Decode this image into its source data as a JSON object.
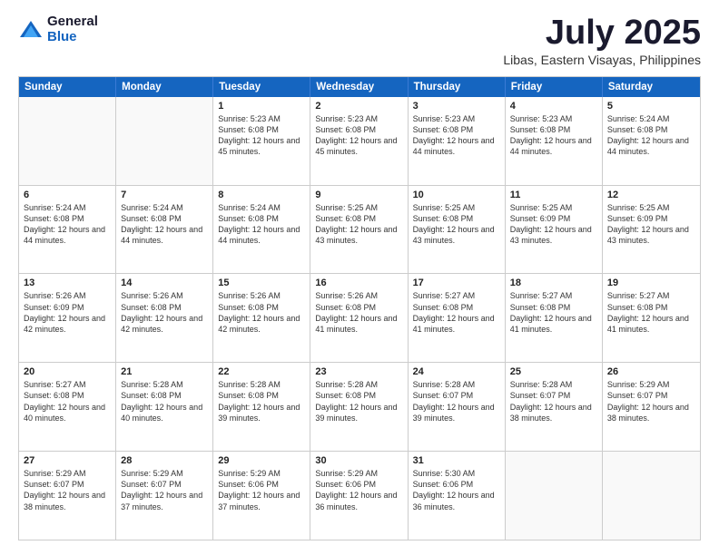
{
  "logo": {
    "general": "General",
    "blue": "Blue"
  },
  "title": "July 2025",
  "location": "Libas, Eastern Visayas, Philippines",
  "header_days": [
    "Sunday",
    "Monday",
    "Tuesday",
    "Wednesday",
    "Thursday",
    "Friday",
    "Saturday"
  ],
  "weeks": [
    [
      {
        "day": "",
        "info": ""
      },
      {
        "day": "",
        "info": ""
      },
      {
        "day": "1",
        "info": "Sunrise: 5:23 AM\nSunset: 6:08 PM\nDaylight: 12 hours and 45 minutes."
      },
      {
        "day": "2",
        "info": "Sunrise: 5:23 AM\nSunset: 6:08 PM\nDaylight: 12 hours and 45 minutes."
      },
      {
        "day": "3",
        "info": "Sunrise: 5:23 AM\nSunset: 6:08 PM\nDaylight: 12 hours and 44 minutes."
      },
      {
        "day": "4",
        "info": "Sunrise: 5:23 AM\nSunset: 6:08 PM\nDaylight: 12 hours and 44 minutes."
      },
      {
        "day": "5",
        "info": "Sunrise: 5:24 AM\nSunset: 6:08 PM\nDaylight: 12 hours and 44 minutes."
      }
    ],
    [
      {
        "day": "6",
        "info": "Sunrise: 5:24 AM\nSunset: 6:08 PM\nDaylight: 12 hours and 44 minutes."
      },
      {
        "day": "7",
        "info": "Sunrise: 5:24 AM\nSunset: 6:08 PM\nDaylight: 12 hours and 44 minutes."
      },
      {
        "day": "8",
        "info": "Sunrise: 5:24 AM\nSunset: 6:08 PM\nDaylight: 12 hours and 44 minutes."
      },
      {
        "day": "9",
        "info": "Sunrise: 5:25 AM\nSunset: 6:08 PM\nDaylight: 12 hours and 43 minutes."
      },
      {
        "day": "10",
        "info": "Sunrise: 5:25 AM\nSunset: 6:08 PM\nDaylight: 12 hours and 43 minutes."
      },
      {
        "day": "11",
        "info": "Sunrise: 5:25 AM\nSunset: 6:09 PM\nDaylight: 12 hours and 43 minutes."
      },
      {
        "day": "12",
        "info": "Sunrise: 5:25 AM\nSunset: 6:09 PM\nDaylight: 12 hours and 43 minutes."
      }
    ],
    [
      {
        "day": "13",
        "info": "Sunrise: 5:26 AM\nSunset: 6:09 PM\nDaylight: 12 hours and 42 minutes."
      },
      {
        "day": "14",
        "info": "Sunrise: 5:26 AM\nSunset: 6:08 PM\nDaylight: 12 hours and 42 minutes."
      },
      {
        "day": "15",
        "info": "Sunrise: 5:26 AM\nSunset: 6:08 PM\nDaylight: 12 hours and 42 minutes."
      },
      {
        "day": "16",
        "info": "Sunrise: 5:26 AM\nSunset: 6:08 PM\nDaylight: 12 hours and 41 minutes."
      },
      {
        "day": "17",
        "info": "Sunrise: 5:27 AM\nSunset: 6:08 PM\nDaylight: 12 hours and 41 minutes."
      },
      {
        "day": "18",
        "info": "Sunrise: 5:27 AM\nSunset: 6:08 PM\nDaylight: 12 hours and 41 minutes."
      },
      {
        "day": "19",
        "info": "Sunrise: 5:27 AM\nSunset: 6:08 PM\nDaylight: 12 hours and 41 minutes."
      }
    ],
    [
      {
        "day": "20",
        "info": "Sunrise: 5:27 AM\nSunset: 6:08 PM\nDaylight: 12 hours and 40 minutes."
      },
      {
        "day": "21",
        "info": "Sunrise: 5:28 AM\nSunset: 6:08 PM\nDaylight: 12 hours and 40 minutes."
      },
      {
        "day": "22",
        "info": "Sunrise: 5:28 AM\nSunset: 6:08 PM\nDaylight: 12 hours and 39 minutes."
      },
      {
        "day": "23",
        "info": "Sunrise: 5:28 AM\nSunset: 6:08 PM\nDaylight: 12 hours and 39 minutes."
      },
      {
        "day": "24",
        "info": "Sunrise: 5:28 AM\nSunset: 6:07 PM\nDaylight: 12 hours and 39 minutes."
      },
      {
        "day": "25",
        "info": "Sunrise: 5:28 AM\nSunset: 6:07 PM\nDaylight: 12 hours and 38 minutes."
      },
      {
        "day": "26",
        "info": "Sunrise: 5:29 AM\nSunset: 6:07 PM\nDaylight: 12 hours and 38 minutes."
      }
    ],
    [
      {
        "day": "27",
        "info": "Sunrise: 5:29 AM\nSunset: 6:07 PM\nDaylight: 12 hours and 38 minutes."
      },
      {
        "day": "28",
        "info": "Sunrise: 5:29 AM\nSunset: 6:07 PM\nDaylight: 12 hours and 37 minutes."
      },
      {
        "day": "29",
        "info": "Sunrise: 5:29 AM\nSunset: 6:06 PM\nDaylight: 12 hours and 37 minutes."
      },
      {
        "day": "30",
        "info": "Sunrise: 5:29 AM\nSunset: 6:06 PM\nDaylight: 12 hours and 36 minutes."
      },
      {
        "day": "31",
        "info": "Sunrise: 5:30 AM\nSunset: 6:06 PM\nDaylight: 12 hours and 36 minutes."
      },
      {
        "day": "",
        "info": ""
      },
      {
        "day": "",
        "info": ""
      }
    ]
  ]
}
